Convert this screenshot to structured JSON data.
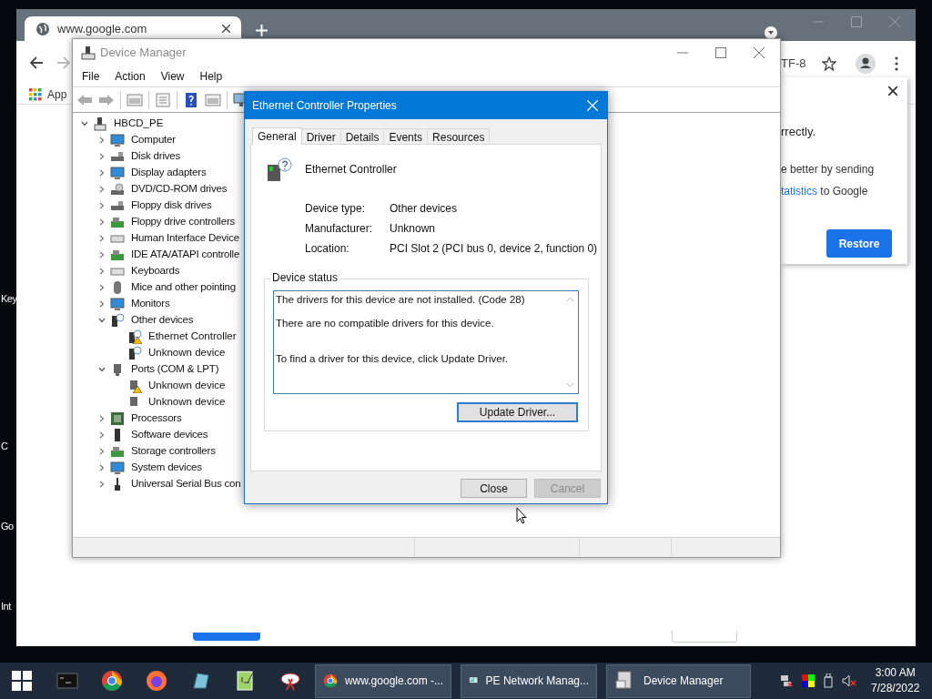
{
  "desktop": {
    "icon_labels": [
      "Key",
      "C",
      "Go",
      "Int"
    ]
  },
  "browser": {
    "tab": {
      "title": "www.google.com"
    },
    "encoding": "TF-8",
    "bookmarks": [
      "App"
    ],
    "popup": {
      "lines": [
        "rrectly.",
        "e better by sending"
      ],
      "link": "tatistics",
      "link_suffix": " to Google",
      "button": "Restore"
    }
  },
  "device_manager": {
    "title": "Device Manager",
    "menu": [
      "File",
      "Action",
      "View",
      "Help"
    ],
    "tree": {
      "label": "HBCD_PE",
      "expanded": true,
      "children": [
        {
          "label": "Computer",
          "expanded": false
        },
        {
          "label": "Disk drives",
          "expanded": false
        },
        {
          "label": "Display adapters",
          "expanded": false
        },
        {
          "label": "DVD/CD-ROM drives",
          "expanded": false
        },
        {
          "label": "Floppy disk drives",
          "expanded": false
        },
        {
          "label": "Floppy drive controllers",
          "expanded": false
        },
        {
          "label": "Human Interface Device",
          "expanded": false
        },
        {
          "label": "IDE ATA/ATAPI controlle",
          "expanded": false
        },
        {
          "label": "Keyboards",
          "expanded": false
        },
        {
          "label": "Mice and other pointing",
          "expanded": false
        },
        {
          "label": "Monitors",
          "expanded": false
        },
        {
          "label": "Other devices",
          "expanded": true,
          "children": [
            {
              "label": "Ethernet Controller",
              "warning": true
            },
            {
              "label": "Unknown device",
              "warning": false
            }
          ]
        },
        {
          "label": "Ports (COM & LPT)",
          "expanded": true,
          "children": [
            {
              "label": "Unknown device",
              "warning": true
            },
            {
              "label": "Unknown device",
              "warning": false
            }
          ]
        },
        {
          "label": "Processors",
          "expanded": false
        },
        {
          "label": "Software devices",
          "expanded": false
        },
        {
          "label": "Storage controllers",
          "expanded": false
        },
        {
          "label": "System devices",
          "expanded": false
        },
        {
          "label": "Universal Serial Bus con",
          "expanded": false
        }
      ]
    }
  },
  "properties": {
    "title": "Ethernet Controller Properties",
    "tabs": [
      {
        "label": "General",
        "selected": true
      },
      {
        "label": "Driver",
        "selected": false
      },
      {
        "label": "Details",
        "selected": false
      },
      {
        "label": "Events",
        "selected": false
      },
      {
        "label": "Resources",
        "selected": false
      }
    ],
    "device_name": "Ethernet Controller",
    "fields": [
      {
        "label": "Device type:",
        "value": "Other devices"
      },
      {
        "label": "Manufacturer:",
        "value": "Unknown"
      },
      {
        "label": "Location:",
        "value": "PCI Slot 2 (PCI bus 0, device 2, function 0)"
      }
    ],
    "status_group": "Device status",
    "status_text": "The drivers for this device are not installed. (Code 28)\n\nThere are no compatible drivers for this device.\n\n\nTo find a driver for this device, click Update Driver.",
    "update_button": "Update Driver...",
    "buttons": [
      {
        "label": "Close",
        "disabled": false
      },
      {
        "label": "Cancel",
        "disabled": true
      }
    ]
  },
  "taskbar": {
    "tasks": [
      "www.google.com -...",
      "PE Network Manag...",
      "Device Manager"
    ],
    "time": "3:00 AM",
    "date": "7/28/2022"
  }
}
